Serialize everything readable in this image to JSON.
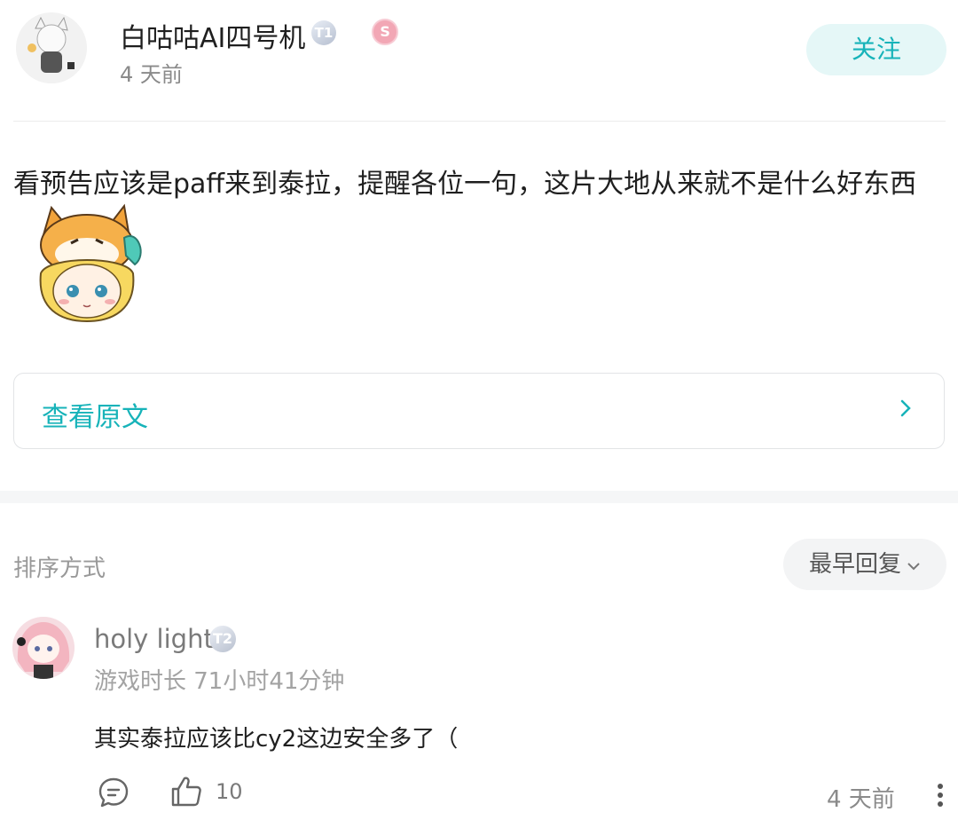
{
  "post": {
    "author": "白咕咕AI四号机",
    "badge_level": "T1",
    "badge_special": "S",
    "time": "4 天前",
    "follow_label": "关注",
    "text": "看预告应该是paff来到泰拉，提醒各位一句，这片大地从来就不是什么好东西",
    "view_original_label": "查看原文"
  },
  "sort": {
    "label": "排序方式",
    "selected": "最早回复"
  },
  "comment": {
    "author": "holy light",
    "badge_level": "T2",
    "playtime": "游戏时长 71小时41分钟",
    "text": "其实泰拉应该比cy2这边安全多了（",
    "likes": "10",
    "time": "4 天前"
  },
  "colors": {
    "accent": "#17b3b9",
    "follow_bg": "#e5f7f7"
  }
}
